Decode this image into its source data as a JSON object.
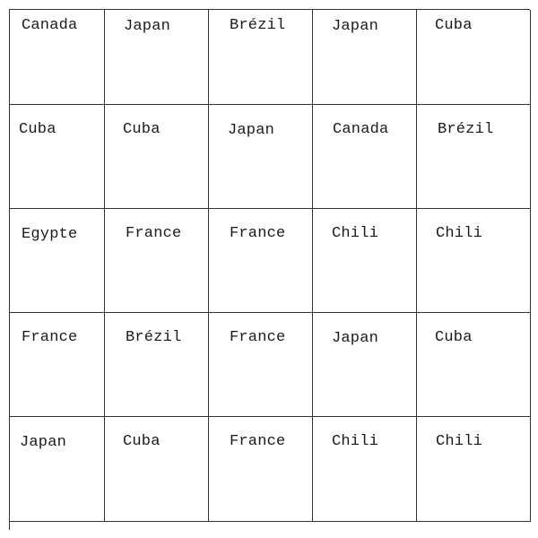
{
  "grid": {
    "rows": [
      [
        "Canada",
        "Japan",
        "Brézil",
        "Japan",
        "Cuba"
      ],
      [
        "Cuba",
        "Cuba",
        "Japan",
        "Canada",
        "Brézil"
      ],
      [
        "Egypte",
        "France",
        "France",
        "Chili",
        "Chili"
      ],
      [
        "France",
        "Brézil",
        "France",
        "Japan",
        "Cuba"
      ],
      [
        "Japan",
        "Cuba",
        "France",
        "Chili",
        "Chili"
      ]
    ]
  }
}
